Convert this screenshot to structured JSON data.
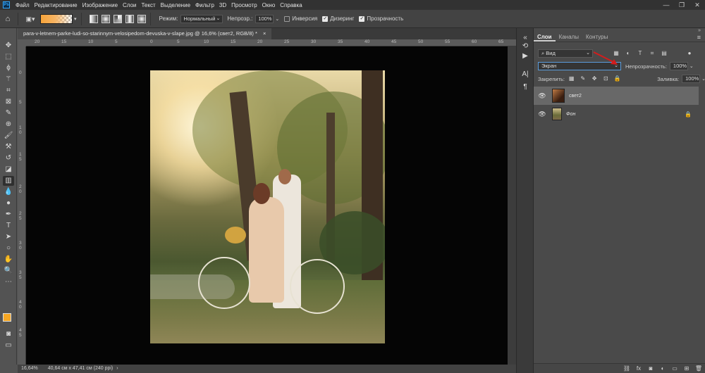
{
  "menubar": {
    "logo": "Ps",
    "items": [
      "Файл",
      "Редактирование",
      "Изображение",
      "Слои",
      "Текст",
      "Выделение",
      "Фильтр",
      "3D",
      "Просмотр",
      "Окно",
      "Справка"
    ],
    "win_minimize": "—",
    "win_restore": "❐",
    "win_close": "✕"
  },
  "options": {
    "home_icon": "home-icon",
    "mode_label": "Режим:",
    "mode_value": "Нормальный",
    "opacity_label": "Непрозр.:",
    "opacity_value": "100%",
    "inverse_label": "Инверсия",
    "dither_label": "Дизеринг",
    "transparency_label": "Прозрачность",
    "gradient_colors": [
      "#f7a43a",
      "#f7b463"
    ]
  },
  "document": {
    "tab_title": "para-v-letnem-parke-ludi-so-starinnym-velosipedom-devuska-v-slape.jpg @ 16,6% (свет2, RGB/8) *",
    "tab_close": "×"
  },
  "rulers": {
    "horizontal": [
      "20",
      "15",
      "10",
      "5",
      "0",
      "5",
      "10",
      "15",
      "20",
      "25",
      "30",
      "35",
      "40",
      "45",
      "50",
      "55",
      "60",
      "65"
    ],
    "vertical": [
      "0",
      "5",
      "1 0",
      "1 5",
      "2 0",
      "2 5",
      "3 0",
      "3 5",
      "4 0",
      "4 5"
    ]
  },
  "status": {
    "zoom": "16,64%",
    "doc_size": "40,64 см x 47,41 см (240 ppi)",
    "arrow": "›"
  },
  "layers_panel": {
    "tabs": [
      "Слои",
      "Каналы",
      "Контуры"
    ],
    "active_tab": "Слои",
    "menu_icon": "≡",
    "filter_kind": "Вид",
    "blend_mode": "Экран",
    "opacity_label": "Непрозрачность:",
    "opacity_value": "100%",
    "lock_label": "Закрепить:",
    "fill_label": "Заливка:",
    "fill_value": "100%",
    "layers": [
      {
        "name": "свет2",
        "visible": true,
        "selected": true,
        "locked": false
      },
      {
        "name": "Фон",
        "visible": true,
        "selected": false,
        "locked": true
      }
    ]
  },
  "colors": {
    "foreground": "#f5a623",
    "background": "#9fd7d9",
    "accent_arrow": "#d41c1c"
  }
}
